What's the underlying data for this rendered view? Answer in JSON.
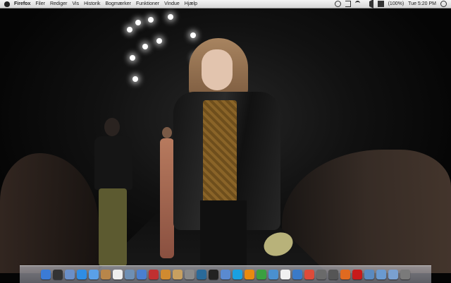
{
  "menubar": {
    "app_name": "Firefox",
    "items": [
      "Filer",
      "Rediger",
      "Vis",
      "Historik",
      "Bogmærker",
      "Funktioner",
      "Vindue",
      "Hjælp"
    ],
    "battery": "(100%)",
    "clock": "Tue 5:20 PM",
    "icons": [
      "apple-icon",
      "sync-icon",
      "bluetooth-icon",
      "wifi-icon",
      "volume-icon",
      "battery-icon",
      "search-icon"
    ]
  },
  "dock": {
    "icons": [
      {
        "name": "finder-icon",
        "color": "#3b7bd6"
      },
      {
        "name": "dashboard-icon",
        "color": "#333333"
      },
      {
        "name": "mail-icon",
        "color": "#6a8fc8"
      },
      {
        "name": "safari-icon",
        "color": "#2f8de4"
      },
      {
        "name": "ichat-icon",
        "color": "#5aa0e8"
      },
      {
        "name": "address-book-icon",
        "color": "#b8864a"
      },
      {
        "name": "ical-icon",
        "color": "#eeeeee"
      },
      {
        "name": "preview-icon",
        "color": "#6e8fb4"
      },
      {
        "name": "itunes-icon",
        "color": "#4a7fd0"
      },
      {
        "name": "photo-booth-icon",
        "color": "#c03030"
      },
      {
        "name": "iphoto-icon",
        "color": "#d08a30"
      },
      {
        "name": "garageband-icon",
        "color": "#c8a060"
      },
      {
        "name": "system-preferences-icon",
        "color": "#8a8a8a"
      },
      {
        "name": "time-machine-icon",
        "color": "#2a6a9a"
      },
      {
        "name": "terminal-icon",
        "color": "#222222"
      },
      {
        "name": "automator-icon",
        "color": "#5a8ad0"
      },
      {
        "name": "skype-icon",
        "color": "#1aa0e0"
      },
      {
        "name": "vlc-icon",
        "color": "#e88a10"
      },
      {
        "name": "adium-icon",
        "color": "#3aa040"
      },
      {
        "name": "utility-icon",
        "color": "#4a90d0"
      },
      {
        "name": "textedit-icon",
        "color": "#f0f0f0"
      },
      {
        "name": "world-icon",
        "color": "#3a7ac8"
      },
      {
        "name": "chrome-icon",
        "color": "#dd4b39"
      },
      {
        "name": "app-store-icon",
        "color": "#6a6a6a"
      },
      {
        "name": "folder-icon",
        "color": "#555555"
      },
      {
        "name": "firefox-icon",
        "color": "#e06a20"
      },
      {
        "name": "acrobat-icon",
        "color": "#c81a1a"
      },
      {
        "name": "applications-folder-icon",
        "color": "#5a8ac0"
      },
      {
        "name": "documents-folder-icon",
        "color": "#6a9ad0"
      },
      {
        "name": "downloads-folder-icon",
        "color": "#7aa0d0"
      },
      {
        "name": "trash-icon",
        "color": "#7a7a7a"
      }
    ]
  }
}
